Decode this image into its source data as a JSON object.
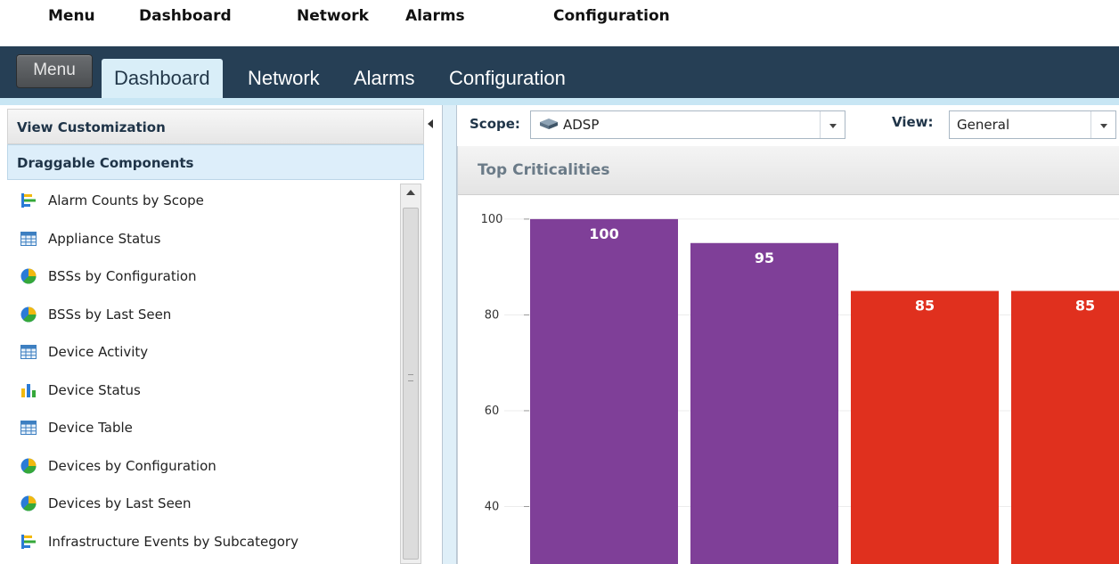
{
  "callouts": [
    "Menu",
    "Dashboard",
    "Network",
    "Alarms",
    "Configuration"
  ],
  "nav": {
    "menu_label": "Menu",
    "tabs": [
      "Dashboard",
      "Network",
      "Alarms",
      "Configuration"
    ],
    "active_tab": "Dashboard",
    "bar_color": "#263f55"
  },
  "left_panel": {
    "header1": "View Customization",
    "header2": "Draggable Components",
    "items": [
      {
        "label": "Alarm Counts by Scope",
        "icon": "hbar-chart-icon"
      },
      {
        "label": "Appliance Status",
        "icon": "table-icon"
      },
      {
        "label": "BSSs by Configuration",
        "icon": "pie-chart-icon"
      },
      {
        "label": "BSSs by Last Seen",
        "icon": "pie-chart-icon"
      },
      {
        "label": "Device Activity",
        "icon": "table-icon"
      },
      {
        "label": "Device Status",
        "icon": "vbar-chart-icon"
      },
      {
        "label": "Device Table",
        "icon": "table-icon"
      },
      {
        "label": "Devices by Configuration",
        "icon": "pie-chart-icon"
      },
      {
        "label": "Devices by Last Seen",
        "icon": "pie-chart-icon"
      },
      {
        "label": "Infrastructure Events by Subcategory",
        "icon": "hbar-chart-icon"
      }
    ]
  },
  "scope": {
    "label": "Scope:",
    "value": "ADSP",
    "icon": "appliance-icon"
  },
  "view": {
    "label": "View:",
    "value": "General"
  },
  "chart_title": "Top Criticalities",
  "chart_data": {
    "type": "bar",
    "title": "Top Criticalities",
    "values": [
      100,
      95,
      85,
      85
    ],
    "data_labels": [
      "100",
      "95",
      "85",
      "85"
    ],
    "colors": [
      "#7f3f98",
      "#7f3f98",
      "#e0301e",
      "#e0301e"
    ],
    "yticks": [
      "100",
      "80",
      "60",
      "40"
    ],
    "ylim_visible": [
      28,
      105
    ],
    "grid": true
  }
}
